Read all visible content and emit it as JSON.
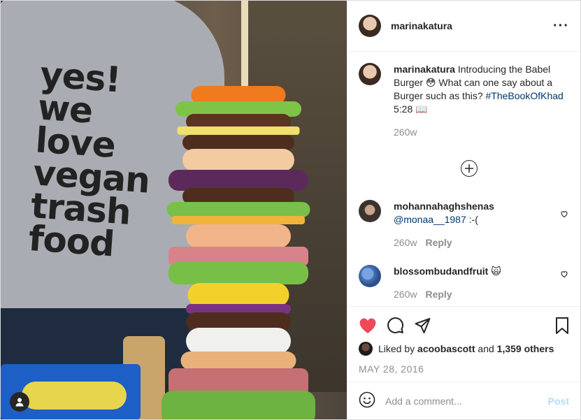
{
  "post": {
    "author": "marinakatura",
    "more_icon": "more-horizontal-icon",
    "media": {
      "shirt_lines": [
        "yes!",
        "we",
        "love",
        "vegan",
        "trash",
        "food"
      ]
    }
  },
  "caption": {
    "username": "marinakatura",
    "text_before": "Introducing the Babel Burger ",
    "emoji": "😳",
    "text_after": " What can one say about a Burger such as this? ",
    "hashtag": "#TheBookOfKhad",
    "tail": " 5:28 📖",
    "age": "260w"
  },
  "comments": [
    {
      "username": "mohannahaghshenas",
      "mention": "@monaa__1987",
      "text": " :-(",
      "age": "260w",
      "reply_label": "Reply",
      "avatar_color": "#3a3430"
    },
    {
      "username": "blossombudandfruit",
      "text": " 🙀",
      "age": "260w",
      "reply_label": "Reply",
      "avatar_color": "#4a78b8"
    }
  ],
  "actions": {
    "liked_prefix": "Liked by ",
    "liked_user": "acoobascott",
    "liked_mid": " and ",
    "liked_count": "1,359 others",
    "date": "MAY 28, 2016"
  },
  "composer": {
    "placeholder": "Add a comment...",
    "post_label": "Post"
  },
  "colors": {
    "like_red": "#ed4956",
    "link_blue": "#00376b",
    "post_disabled": "#b3dbff",
    "muted": "#8e8e8e"
  }
}
